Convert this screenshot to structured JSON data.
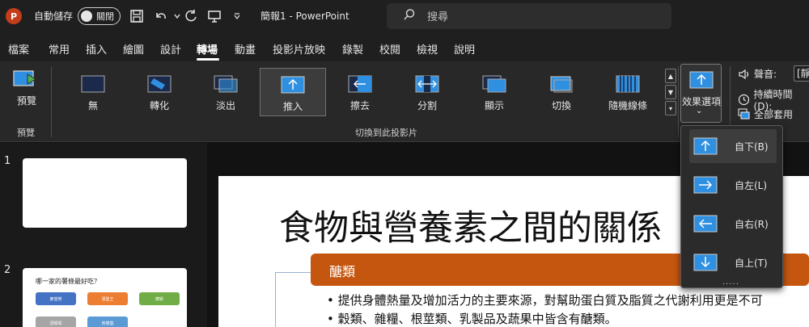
{
  "titlebar": {
    "app_icon_letter": "P",
    "autosave_label": "自動儲存",
    "autosave_state": "關閉",
    "doc_title": "簡報1  -  PowerPoint",
    "search_placeholder": "搜尋"
  },
  "menu": {
    "tabs": [
      "檔案",
      "常用",
      "插入",
      "繪圖",
      "設計",
      "轉場",
      "動畫",
      "投影片放映",
      "錄製",
      "校閱",
      "檢視",
      "說明"
    ],
    "active": "轉場"
  },
  "ribbon": {
    "preview_label": "預覽",
    "preview_group": "預覽",
    "gallery_group": "切換到此投影片",
    "transitions": [
      "無",
      "轉化",
      "淡出",
      "推入",
      "擦去",
      "分割",
      "顯示",
      "切換",
      "隨機線條"
    ],
    "selected_transition": "推入",
    "effect_options_label": "效果選項",
    "sound_label": "聲音:",
    "sound_value": "[靜",
    "duration_label": "持續時間(D):",
    "apply_all_label": "全部套用"
  },
  "dropdown": {
    "items": [
      "自下(B)",
      "自左(L)",
      "自右(R)",
      "自上(T)"
    ],
    "selected": "自下(B)",
    "more": "....."
  },
  "thumbnails": {
    "numbers": [
      "1",
      "2"
    ],
    "slide2_title": "哪一家的薯條最好吃？",
    "slide2_boxes": [
      {
        "label": "麥當勞",
        "color": "#4472c4"
      },
      {
        "label": "漢堡王",
        "color": "#ed7d31"
      },
      {
        "label": "摩斯",
        "color": "#70ad47"
      },
      {
        "label": "頂呱呱",
        "color": "#a5a5a5"
      },
      {
        "label": "肯德基",
        "color": "#5b9bd5"
      }
    ]
  },
  "slide": {
    "title": "食物與營養素之間的關係",
    "section": "醣類",
    "bullets": [
      "提供身體熱量及增加活力的主要來源，對幫助蛋白質及脂質之代謝利用更是不可",
      "穀類、雜糧、根莖類、乳製品及蔬果中皆含有醣類。"
    ]
  },
  "colors": {
    "accent_orange": "#c5560f",
    "app_red": "#c43e1c",
    "icon_blue": "#2f8fe0"
  }
}
